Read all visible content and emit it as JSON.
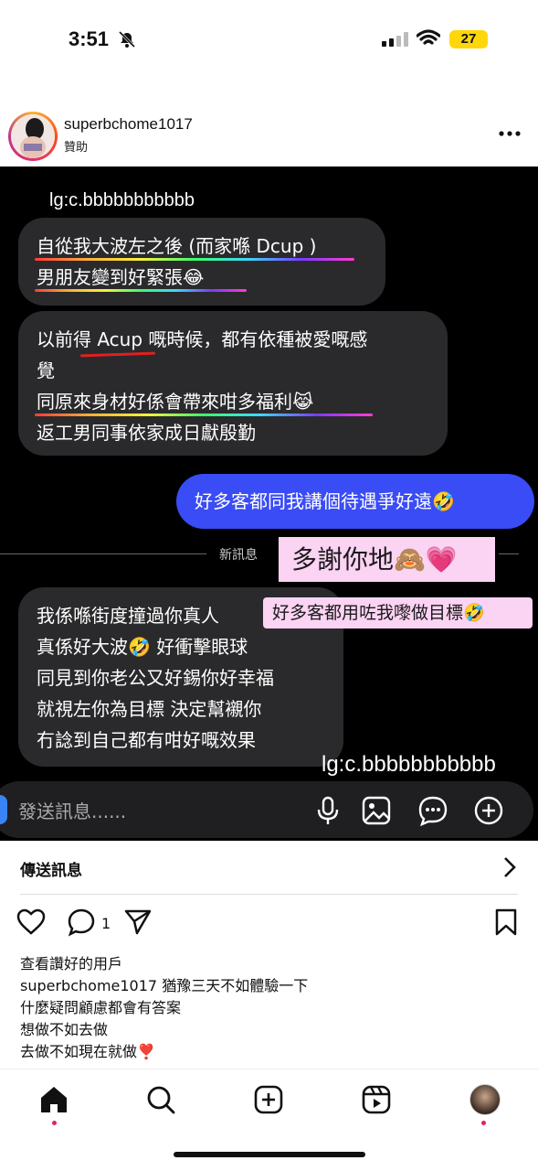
{
  "status_bar": {
    "time": "3:51",
    "battery": "27"
  },
  "post": {
    "username": "superbchome1017",
    "sponsored": "贊助"
  },
  "chat": {
    "watermark_top": "lg:c.bbbbbbbbbbb",
    "watermark_bottom": "lg:c.bbbbbbbbbbb",
    "bubble1": {
      "line1": "自從我大波左之後 (而家喺 Dcup )",
      "line2": "男朋友變到好緊張😂"
    },
    "bubble2": {
      "line1": "以前得 Acup 嘅時候，都有依種被愛嘅感",
      "line2": "覺",
      "line3": "同原來身材好係會帶來咁多福利😹",
      "line4": "返工男同事依家成日獻殷勤"
    },
    "outgoing": "好多客都同我講個待遇爭好遠🤣",
    "new_messages": "新訊息",
    "sticker1": "多謝你地🙈💗",
    "sticker2": "好多客都用咗我嚟做目標🤣",
    "bubble3": {
      "line1": "我係喺街度撞過你真人",
      "line2": "真係好大波🤣 好衝擊眼球",
      "line3": "同見到你老公又好錫你好幸福",
      "line4": "就視左你為目標  決定幫襯你",
      "line5": "冇諗到自己都有咁好嘅效果"
    },
    "composer_placeholder": "發送訊息......"
  },
  "send_message": {
    "label": "傳送訊息"
  },
  "actions": {
    "comment_count": "1"
  },
  "caption": {
    "likes": "查看讚好的用戶",
    "username": "superbchome1017",
    "line1": "猶豫三天不如體驗一下",
    "line2": "什麼疑問顧慮都會有答案",
    "line3": "想做不如去做",
    "line4": "去做不如現在就做❣️"
  },
  "colors": {
    "outgoing_bubble": "#3a4cf5",
    "incoming_bubble": "#2a2a2c",
    "sticker_bg": "#fbd3f3",
    "nav_dot": "#e0245e"
  }
}
